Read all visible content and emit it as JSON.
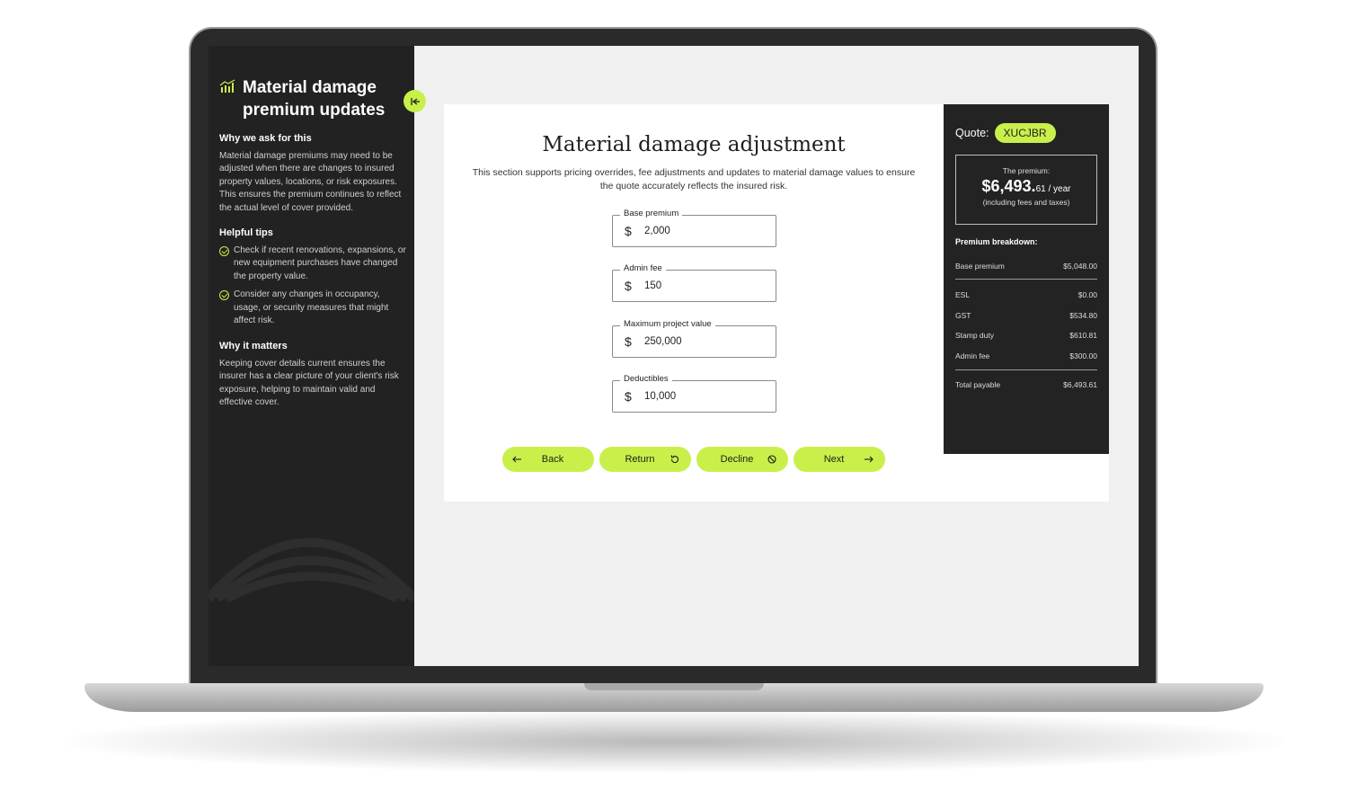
{
  "sidebar": {
    "title_line1": "Material damage",
    "title_line2": "premium updates",
    "why_heading": "Why we ask for this",
    "why_text": "Material damage premiums may need to be adjusted when there are changes to insured property values, locations, or risk exposures. This ensures the premium continues to reflect the actual level of cover provided.",
    "tips_heading": "Helpful tips",
    "tips": [
      "Check if recent renovations, expansions, or new equipment purchases have changed the property value.",
      "Consider any changes in occupancy, usage, or security measures that might affect risk."
    ],
    "matters_heading": "Why it matters",
    "matters_text": "Keeping cover details current ensures the insurer has a clear picture of your client's risk exposure, helping to maintain valid and effective cover."
  },
  "main": {
    "title": "Material damage adjustment",
    "description": "This section supports pricing overrides, fee adjustments and updates to material damage values to ensure the quote accurately reflects the insured risk.",
    "fields": [
      {
        "label": "Base premium",
        "currency": "$",
        "value": "2,000"
      },
      {
        "label": "Admin fee",
        "currency": "$",
        "value": "150"
      },
      {
        "label": "Maximum project value",
        "currency": "$",
        "value": "250,000"
      },
      {
        "label": "Deductibles",
        "currency": "$",
        "value": "10,000"
      }
    ],
    "buttons": {
      "back": "Back",
      "return": "Return",
      "decline": "Decline",
      "next": "Next"
    }
  },
  "quote": {
    "label": "Quote:",
    "code": "XUCJBR",
    "premium_label": "The premium:",
    "premium_dollars": "$6,493.",
    "premium_cents": "61",
    "premium_period": " / year",
    "premium_note": "(including fees and taxes)",
    "breakdown_title": "Premium breakdown:",
    "rows": [
      {
        "label": "Base premium",
        "value": "$5,048.00"
      },
      {
        "label": "ESL",
        "value": "$0.00"
      },
      {
        "label": "GST",
        "value": "$534.80"
      },
      {
        "label": "Stamp duty",
        "value": "$610.81"
      },
      {
        "label": "Admin fee",
        "value": "$300.00"
      },
      {
        "label": "Total payable",
        "value": "$6,493.61"
      }
    ]
  },
  "colors": {
    "accent": "#c9f04a",
    "sidebar_bg": "#222222",
    "screen_bg": "#f0f0f0"
  },
  "icons": {
    "sidebar_title": "chart-icon",
    "collapse": "collapse-arrow-icon",
    "tip": "check-circle-icon",
    "back": "arrow-left-icon",
    "return": "refresh-icon",
    "decline": "prohibited-icon",
    "next": "arrow-right-icon"
  }
}
